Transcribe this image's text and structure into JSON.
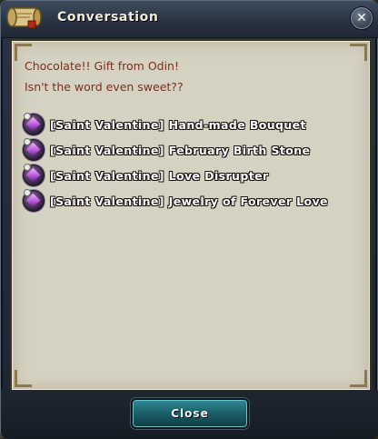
{
  "window": {
    "title": "Conversation"
  },
  "dialog": {
    "line1": "Chocolate!! Gift from Odin!",
    "line2": "Isn't the word even sweet??"
  },
  "items": [
    {
      "label": "[Saint Valentine] Hand-made Bouquet",
      "icon": "gift-gem-icon"
    },
    {
      "label": "[Saint Valentine] February Birth Stone",
      "icon": "gift-gem-icon"
    },
    {
      "label": "[Saint Valentine] Love Disrupter",
      "icon": "gift-gem-icon"
    },
    {
      "label": "[Saint Valentine] Jewelry of Forever Love",
      "icon": "gift-gem-icon"
    }
  ],
  "footer": {
    "close_label": "Close"
  },
  "colors": {
    "dialog_text": "#7a2f1d",
    "panel_bg": "#d6d2c2",
    "button_teal": "#1b5e68"
  }
}
